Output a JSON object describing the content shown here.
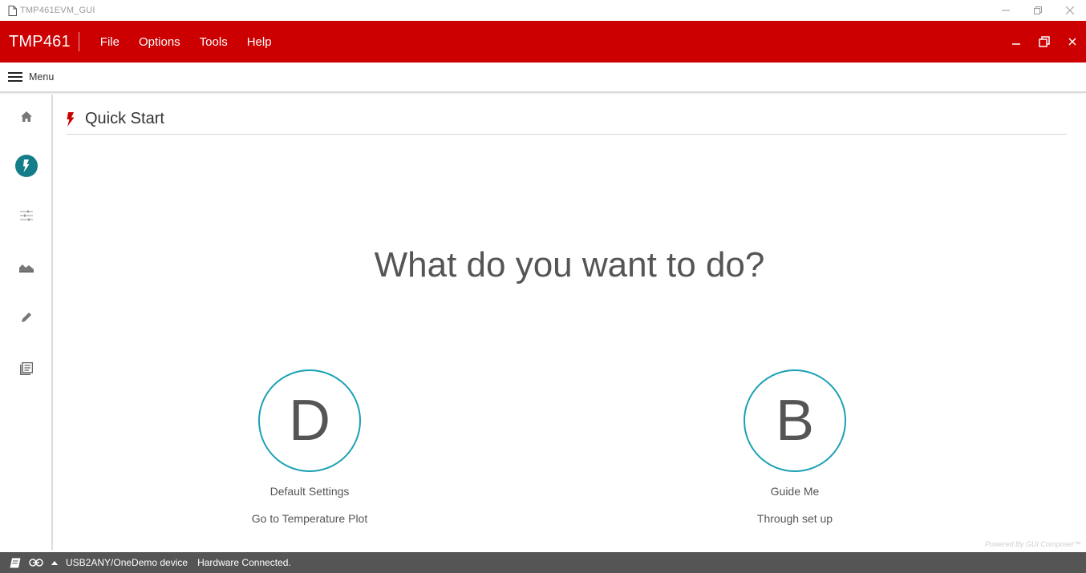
{
  "window": {
    "title": "TMP461EVM_GUI"
  },
  "header": {
    "app_name": "TMP461",
    "menu": [
      "File",
      "Options",
      "Tools",
      "Help"
    ]
  },
  "menubar": {
    "label": "Menu"
  },
  "leftrail": {
    "items": [
      "home-icon",
      "quick-start-bolt-icon",
      "sliders-icon",
      "area-chart-icon",
      "pencil-icon",
      "registers-icon"
    ],
    "active": "quick-start-bolt-icon"
  },
  "main": {
    "section_title": "Quick Start",
    "headline": "What do you want to do?",
    "choices": [
      {
        "letter": "D",
        "label": "Default Settings",
        "sub": "Go to Temperature Plot"
      },
      {
        "letter": "B",
        "label": "Guide Me",
        "sub": "Through set up"
      }
    ],
    "powered_by": "Powered By GUI Composer™"
  },
  "status": {
    "device": "USB2ANY/OneDemo device",
    "connection": "Hardware Connected."
  },
  "colors": {
    "header_red": "#cc0000",
    "accent_teal": "#1aa0b4",
    "status_bg": "#555555"
  }
}
